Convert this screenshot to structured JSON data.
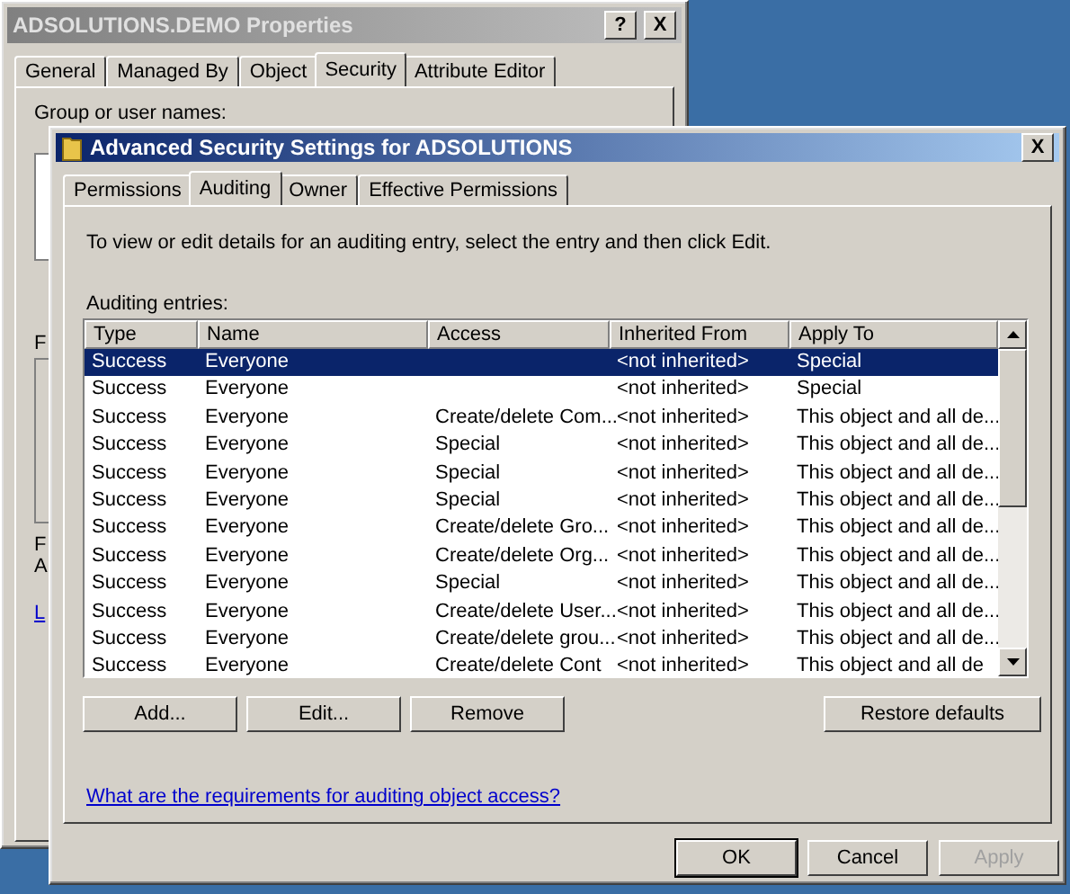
{
  "back_window": {
    "title": "ADSOLUTIONS.DEMO Properties",
    "help_button": "?",
    "close_button": "X",
    "tabs": [
      {
        "label": "General",
        "selected": false
      },
      {
        "label": "Managed By",
        "selected": false
      },
      {
        "label": "Object",
        "selected": false
      },
      {
        "label": "Security",
        "selected": true
      },
      {
        "label": "Attribute Editor",
        "selected": false
      }
    ],
    "group_label": "Group or user names:",
    "fragments": [
      {
        "kind": "text",
        "text": "F"
      },
      {
        "kind": "text",
        "text": "F"
      },
      {
        "kind": "text",
        "text": "A"
      },
      {
        "kind": "link",
        "text": "L"
      }
    ]
  },
  "dialog": {
    "title": "Advanced Security Settings for ADSOLUTIONS",
    "close_button": "X",
    "tabs": [
      {
        "label": "Permissions",
        "selected": false
      },
      {
        "label": "Auditing",
        "selected": true
      },
      {
        "label": "Owner",
        "selected": false
      },
      {
        "label": "Effective Permissions",
        "selected": false
      }
    ],
    "instructions": "To view or edit details for an auditing entry, select the entry and then click Edit.",
    "list_label": "Auditing entries:",
    "table": {
      "columns": [
        "Type",
        "Name",
        "Access",
        "Inherited From",
        "Apply To"
      ],
      "rows": [
        {
          "cells": [
            "Success",
            "Everyone",
            "",
            "<not inherited>",
            "Special"
          ],
          "selected": true
        },
        {
          "cells": [
            "Success",
            "Everyone",
            "",
            "<not inherited>",
            "Special"
          ],
          "selected": false
        },
        {
          "cells": [
            "Success",
            "Everyone",
            "Create/delete Com...",
            "<not inherited>",
            "This object and all de..."
          ],
          "selected": false
        },
        {
          "cells": [
            "Success",
            "Everyone",
            "Special",
            "<not inherited>",
            "This object and all de..."
          ],
          "selected": false
        },
        {
          "cells": [
            "Success",
            "Everyone",
            "Special",
            "<not inherited>",
            "This object and all de..."
          ],
          "selected": false
        },
        {
          "cells": [
            "Success",
            "Everyone",
            "Special",
            "<not inherited>",
            "This object and all de..."
          ],
          "selected": false
        },
        {
          "cells": [
            "Success",
            "Everyone",
            "Create/delete Gro...",
            "<not inherited>",
            "This object and all de..."
          ],
          "selected": false
        },
        {
          "cells": [
            "Success",
            "Everyone",
            "Create/delete Org...",
            "<not inherited>",
            "This object and all de..."
          ],
          "selected": false
        },
        {
          "cells": [
            "Success",
            "Everyone",
            "Special",
            "<not inherited>",
            "This object and all de..."
          ],
          "selected": false
        },
        {
          "cells": [
            "Success",
            "Everyone",
            "Create/delete User...",
            "<not inherited>",
            "This object and all de..."
          ],
          "selected": false
        },
        {
          "cells": [
            "Success",
            "Everyone",
            "Create/delete grou...",
            "<not inherited>",
            "This object and all de..."
          ],
          "selected": false
        },
        {
          "cells": [
            "Success",
            "Everyone",
            "Create/delete Cont",
            "<not inherited>",
            "This object and all de"
          ],
          "selected": false
        }
      ]
    },
    "actions": [
      "Add...",
      "Edit...",
      "Remove"
    ],
    "restore_button": "Restore defaults",
    "help_link": "What are the requirements for auditing object access?",
    "dialog_buttons": [
      {
        "label": "OK",
        "default": true,
        "disabled": false
      },
      {
        "label": "Cancel",
        "default": false,
        "disabled": false
      },
      {
        "label": "Apply",
        "default": false,
        "disabled": true
      }
    ]
  }
}
